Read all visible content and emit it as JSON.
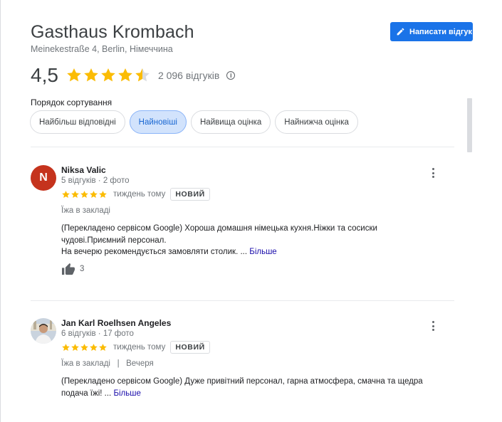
{
  "place": {
    "name": "Gasthaus Krombach",
    "address": "Meinekestraße 4, Berlin, Німеччина"
  },
  "write_review_label": "Написати відгук",
  "summary": {
    "rating": "4,5",
    "rating_value": 4.5,
    "reviews_count": "2 096 відгуків"
  },
  "sort": {
    "label": "Порядок сортування",
    "options": [
      "Найбільш відповідні",
      "Найновіші",
      "Найвища оцінка",
      "Найнижча оцінка"
    ],
    "active": "Найновіші"
  },
  "reviews": [
    {
      "author": "Niksa Valic",
      "initial": "N",
      "avatar_color": "#c5331d",
      "meta": "5 відгуків · 2 фото",
      "stars": 5,
      "time": "тиждень тому",
      "badge": "НОВИЙ",
      "tag": "Їжа в закладі",
      "text_lines": [
        "(Перекладено сервісом Google) Хороша домашня німецька кухня.Ніжки та сосиски",
        "чудові.Приємний персонал.",
        "На вечерю рекомендується замовляти столик. ..."
      ],
      "more_label": "Більше",
      "likes": "3"
    },
    {
      "author": "Jan Karl Roelhsen Angeles",
      "meta": "6 відгуків · 17 фото",
      "stars": 5,
      "time": "тиждень тому",
      "badge": "НОВИЙ",
      "tag": "Їжа в закладі   |   Вечеря",
      "text_lines": [
        "(Перекладено сервісом Google) Дуже привітний персонал, гарна атмосфера, смачна та щедра",
        "подача їжі! ..."
      ],
      "more_label": "Більше"
    }
  ],
  "colors": {
    "star": "#fbbc04",
    "star_empty": "#dadce0",
    "accent": "#1a73e8",
    "link": "#1a0dab"
  },
  "icons": [
    "edit-pencil-icon",
    "star-icon",
    "info-icon",
    "more-vert-icon",
    "thumb-up-icon"
  ]
}
